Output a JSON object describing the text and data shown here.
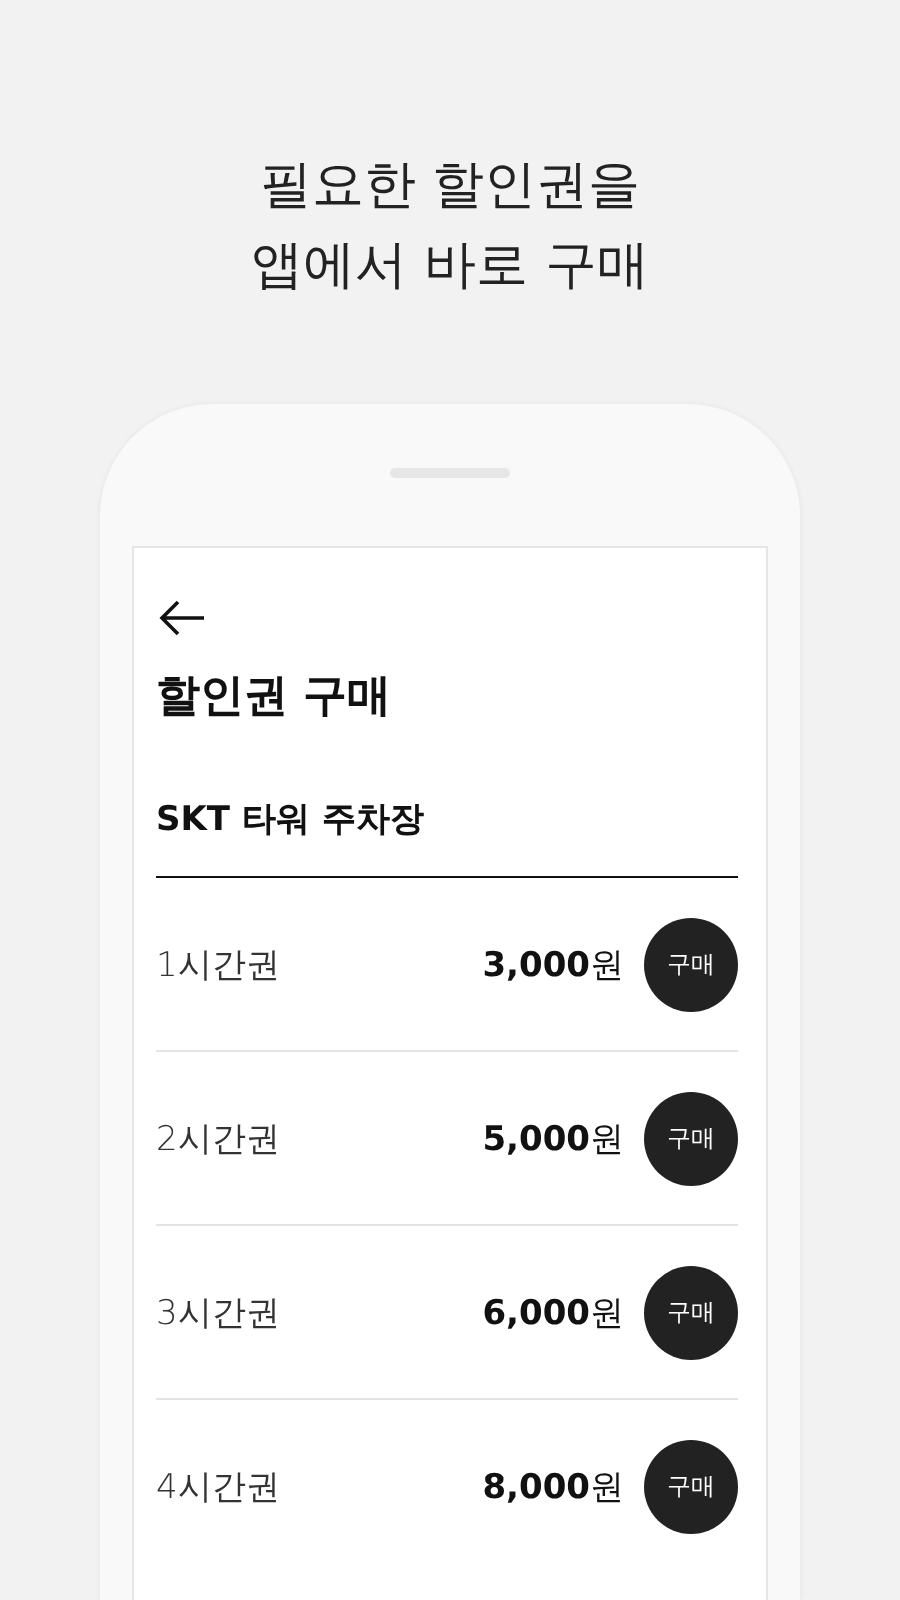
{
  "headline": [
    "필요한 할인권을",
    "앱에서 바로 구매"
  ],
  "screen": {
    "title": "할인권 구매",
    "subtitle": "SKT 타워 주차장",
    "items": [
      {
        "name": "1시간권",
        "price": "**3,000**원",
        "button": "구매"
      },
      {
        "name": "2시간권",
        "price": "**5,000**원",
        "button": "구매"
      },
      {
        "name": "3시간권",
        "price": "**6,000**원",
        "button": "구매"
      },
      {
        "name": "4시간권",
        "price": "**8,000**원",
        "button": "구매"
      }
    ]
  }
}
